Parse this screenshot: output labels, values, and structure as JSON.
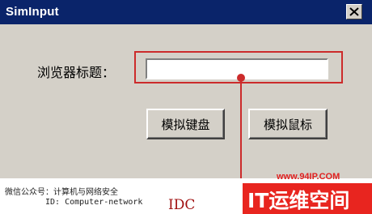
{
  "window": {
    "title": "SimInput",
    "close_label": "×"
  },
  "form": {
    "label": "浏览器标题：",
    "input_value": ""
  },
  "buttons": {
    "keyboard": "模拟键盘",
    "mouse": "模拟鼠标"
  },
  "watermark": {
    "wechat_line": "微信公众号：计算机与网络安全",
    "id_line": "ID: Computer-network",
    "idc_text": "IDC",
    "site_url": "www.94IP.COM",
    "brand_text": "IT运维空间"
  },
  "colors": {
    "titlebar": "#0a246a",
    "window_bg": "#d4d0c8",
    "annotation_red": "#cc2b2b",
    "brand_red": "#e8251f"
  }
}
